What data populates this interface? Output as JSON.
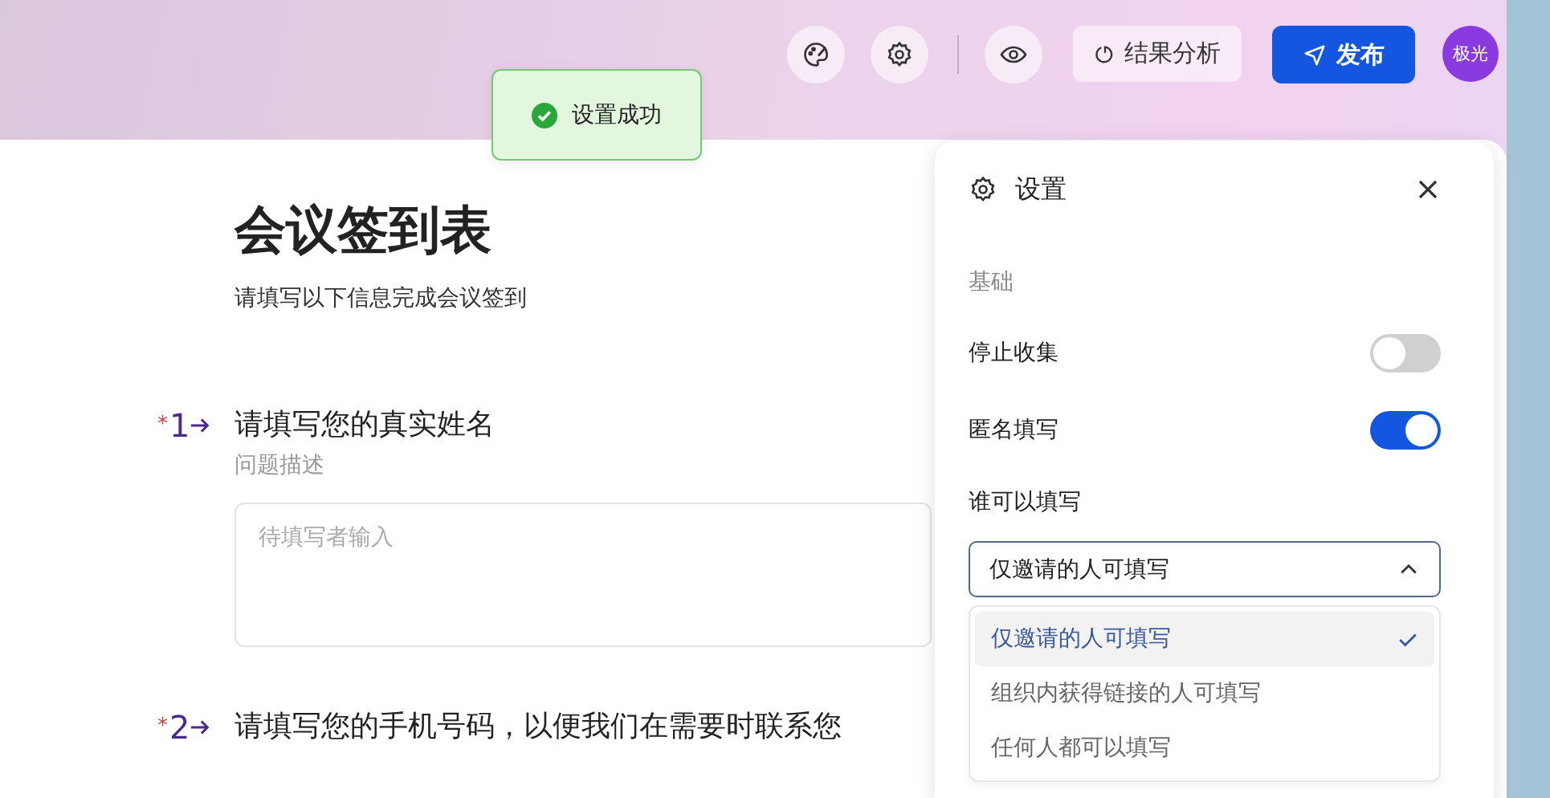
{
  "toolbar": {
    "analysis_button": "结果分析",
    "publish_button": "发布",
    "avatar": "极光"
  },
  "toast": {
    "text": "设置成功"
  },
  "form": {
    "title": "会议签到表",
    "description": "请填写以下信息完成会议签到",
    "questions": [
      {
        "required_mark": "*",
        "number": "1",
        "required": true,
        "title": "请填写您的真实姓名",
        "hint": "问题描述",
        "placeholder": "待填写者输入"
      },
      {
        "required_mark": "*",
        "number": "2",
        "required": true,
        "title": "请填写您的手机号码，以便我们在需要时联系您"
      }
    ]
  },
  "settings": {
    "title": "设置",
    "section": "基础",
    "toggles": [
      {
        "label": "停止收集",
        "on": false
      },
      {
        "label": "匿名填写",
        "on": true
      }
    ],
    "who_label": "谁可以填写",
    "dropdown": {
      "value": "仅邀请的人可填写",
      "expanded": true,
      "options": [
        {
          "label": "仅邀请的人可填写",
          "selected": true
        },
        {
          "label": "组织内获得链接的人可填写",
          "selected": false
        },
        {
          "label": "任何人都可以填写",
          "selected": false
        }
      ]
    }
  }
}
